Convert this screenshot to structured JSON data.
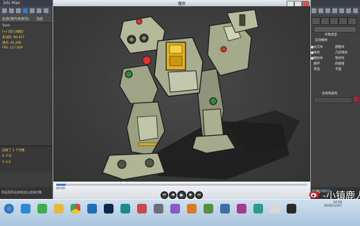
{
  "host_app": {
    "title": "3ds Max"
  },
  "left_panel": {
    "header_a": "名称(按升序排列)",
    "header_b": "冻结",
    "lines": [
      "Tools",
      "[+] [前] [线框]",
      "多边形: 89,457",
      "顶点: 45,296",
      "FPS: 127.049"
    ],
    "bottom_lines": [
      "选择了 1 个对象",
      "X: 0.0",
      "Y: 0.0"
    ]
  },
  "player": {
    "title": "播放",
    "time_label": "00:00",
    "buttons": {
      "prev": "⏮",
      "rewind": "◀",
      "play": "▶",
      "forward": "▶",
      "next": "⏭"
    }
  },
  "right_panel": {
    "title": "对象类型",
    "rows": [
      "自动栅格",
      "长方体",
      "圆锥体",
      "球体",
      "几何球体",
      "圆柱体",
      "管状体",
      "圆环",
      "四棱锥",
      "茶壶",
      "平面"
    ],
    "name_label": "名称和颜色"
  },
  "status": {
    "left": "单击或单击并拖动以选择对象",
    "right": "添加时间标记"
  },
  "taskbar": {
    "clock_time": "14:50",
    "clock_date": "2016/12/07",
    "icons": [
      "start-icon",
      "ie-icon",
      "360-icon",
      "folder-icon",
      "chrome-icon",
      "qq-icon",
      "ps-icon",
      "max-icon",
      "video-icon",
      "player-icon"
    ]
  },
  "watermark": {
    "text": "-小镇鹿人"
  }
}
